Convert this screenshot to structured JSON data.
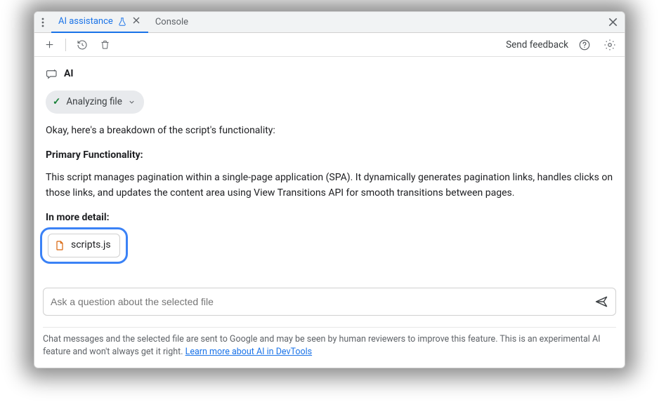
{
  "tabs": {
    "ai_assistance": "AI assistance",
    "console": "Console"
  },
  "toolbar": {
    "feedback": "Send feedback"
  },
  "ai": {
    "title": "AI",
    "status": "Analyzing file",
    "intro": "Okay, here's a breakdown of the script's functionality:",
    "heading1": "Primary Functionality:",
    "body1": "This script manages pagination within a single-page application (SPA). It dynamically generates pagination links, handles clicks on those links, and updates the content area using View Transitions API for smooth transitions between pages.",
    "heading2": "In more detail:"
  },
  "file": {
    "name": "scripts.js"
  },
  "input": {
    "placeholder": "Ask a question about the selected file"
  },
  "footer": {
    "text": "Chat messages and the selected file are sent to Google and may be seen by human reviewers to improve this feature. This is an experimental AI feature and won't always get it right. ",
    "link_text": "Learn more about AI in DevTools"
  }
}
